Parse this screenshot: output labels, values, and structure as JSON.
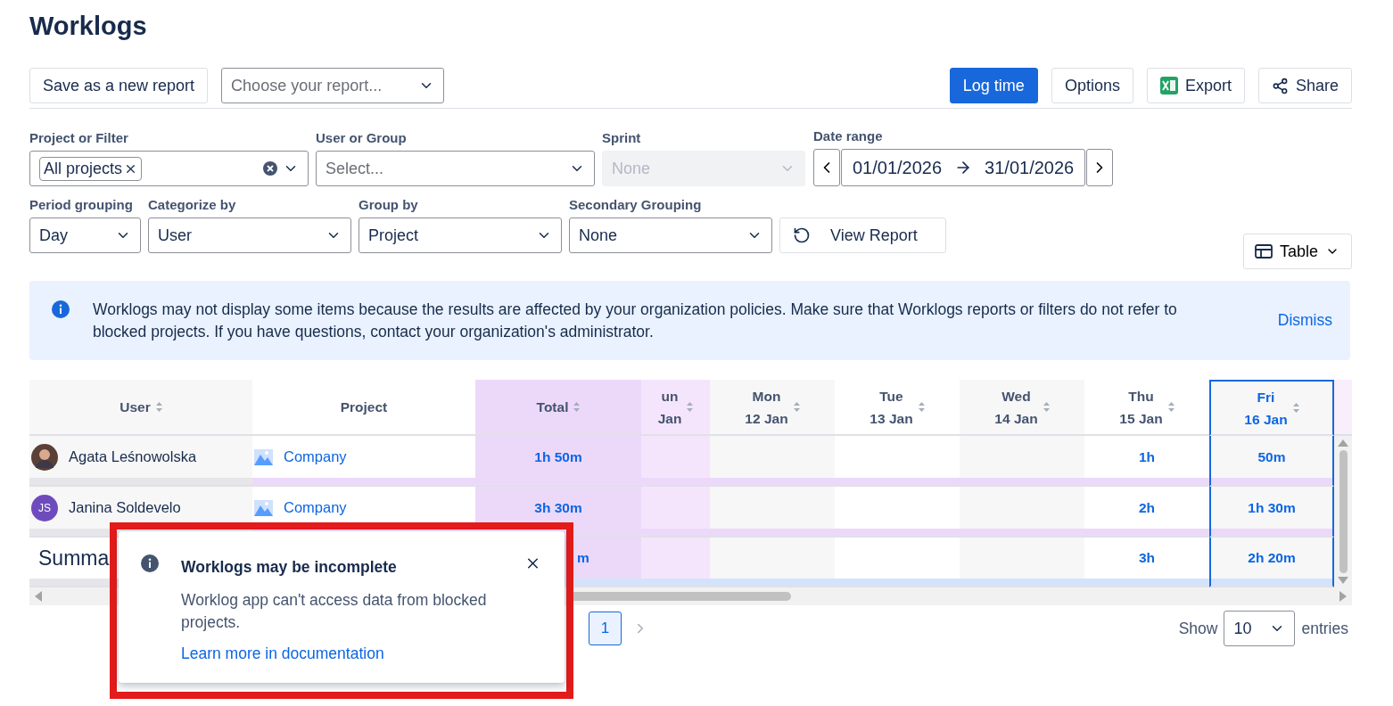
{
  "title": "Worklogs",
  "toolbar": {
    "save_button": "Save as a new report",
    "report_select": {
      "placeholder": "Choose your report..."
    },
    "actions": [
      {
        "kind": "primary",
        "label": "Log time"
      },
      {
        "kind": "plain",
        "label": "Options"
      },
      {
        "kind": "excel",
        "label": "Export"
      },
      {
        "kind": "share",
        "label": "Share"
      }
    ]
  },
  "filters": {
    "project": {
      "label": "Project or Filter",
      "tags": [
        "All projects"
      ]
    },
    "user": {
      "label": "User or Group",
      "placeholder": "Select..."
    },
    "sprint": {
      "label": "Sprint",
      "value": "None",
      "disabled": true
    },
    "date_range": {
      "label": "Date range",
      "from": "01/01/2026",
      "to": "31/01/2026"
    },
    "period": {
      "label": "Period grouping",
      "value": "Day"
    },
    "categorize": {
      "label": "Categorize by",
      "value": "User"
    },
    "group_by": {
      "label": "Group by",
      "value": "Project"
    },
    "secondary": {
      "label": "Secondary Grouping",
      "value": "None"
    },
    "view_button": "View Report",
    "view_toggle": "Table"
  },
  "alert": {
    "text": "Worklogs may not display some items because the results are affected by your organization policies. Make sure that Worklogs reports or filters do not refer to blocked projects. If you have questions, contact your organization's administrator.",
    "dismiss": "Dismiss"
  },
  "table": {
    "user_header": "User",
    "project_header": "Project",
    "total_header": "Total",
    "columns": [
      {
        "day": "un",
        "date": "Jan",
        "weekend": true,
        "selected": false
      },
      {
        "day": "Mon",
        "date": "12 Jan",
        "weekend": false,
        "selected": false
      },
      {
        "day": "Tue",
        "date": "13 Jan",
        "weekend": false,
        "selected": false
      },
      {
        "day": "Wed",
        "date": "14 Jan",
        "weekend": false,
        "selected": false
      },
      {
        "day": "Thu",
        "date": "15 Jan",
        "weekend": false,
        "selected": false
      },
      {
        "day": "Fri",
        "date": "16 Jan",
        "weekend": false,
        "selected": true
      }
    ],
    "rows": [
      {
        "user": "Agata Leśnowolska",
        "avatar": {
          "kind": "photo"
        },
        "project": "Company",
        "total": "1h 50m",
        "days": {
          "4": "1h",
          "5": "50m"
        }
      },
      {
        "user": "Janina Soldevelo",
        "avatar": {
          "kind": "initials",
          "text": "JS"
        },
        "project": "Company",
        "total": "3h 30m",
        "days": {
          "4": "2h",
          "5": "1h 30m"
        }
      }
    ],
    "summary": {
      "label": "Summa",
      "total": "m",
      "days": {
        "4": "3h",
        "5": "2h 20m"
      }
    }
  },
  "pagination": {
    "pages": [
      {
        "label": "1",
        "selected": true
      }
    ],
    "show": "Show",
    "page_size": "10",
    "entries": "entries"
  },
  "toast": {
    "title": "Worklogs may be incomplete",
    "text": "Worklog app can't access data from blocked projects.",
    "link": "Learn more in documentation",
    "highlighted": true
  }
}
